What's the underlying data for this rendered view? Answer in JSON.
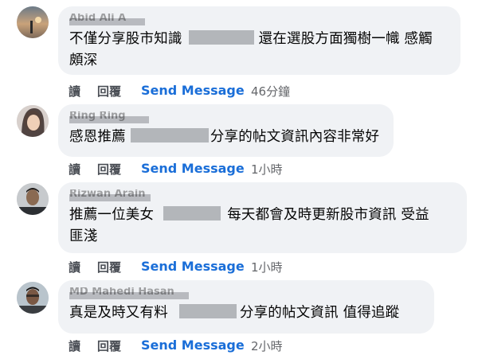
{
  "comments": [
    {
      "name": "Abid Ali A",
      "text_before": "不僅分享股市知識",
      "text_after": "還在選股方面獨樹一幟 感觸頗深",
      "line2": "頗深",
      "line1_after": "還在選股方面獨樹一幟 感觸",
      "reply_label": "讀",
      "reply2_label": "回覆",
      "send_label": "Send Message",
      "time": "46分鐘"
    },
    {
      "name": "Ring Ring",
      "text_before": "感恩推薦",
      "text_after": "分享的帖文資訊內容非常好",
      "reply_label": "讀",
      "reply2_label": "回覆",
      "send_label": "Send Message",
      "time": "1小時"
    },
    {
      "name": "Rizwan Arain",
      "text_before": "推薦一位美女",
      "text_after": "每天都會及時更新股市資訊 受益",
      "line2": "匪淺",
      "reply_label": "讀",
      "reply2_label": "回覆",
      "send_label": "Send Message",
      "time": "1小時"
    },
    {
      "name": "MD Mahedi Hasan",
      "text_before": "真是及時又有料",
      "text_after": "分享的帖文資訊 值得追蹤",
      "reply_label": "讀",
      "reply2_label": "回覆",
      "send_label": "Send Message",
      "time": "2小時"
    }
  ]
}
